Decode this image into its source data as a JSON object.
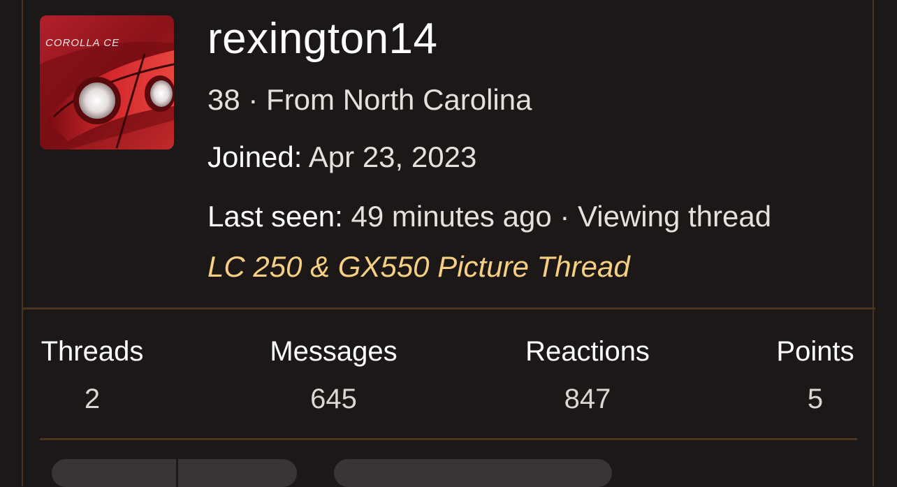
{
  "profile": {
    "username": "rexington14",
    "age_location": "38 · From North Carolina",
    "joined_label": "Joined:",
    "joined_value": "Apr 23, 2023",
    "last_seen_label": "Last seen:",
    "last_seen_value": "49 minutes ago · Viewing thread",
    "viewing_thread_title": "LC 250 & GX550 Picture Thread",
    "avatar_badge_text": "COROLLA CE",
    "avatar_icon": "car-taillight-photo"
  },
  "stats": [
    {
      "label": "Threads",
      "value": "2"
    },
    {
      "label": "Messages",
      "value": "645"
    },
    {
      "label": "Reactions",
      "value": "847"
    },
    {
      "label": "Points",
      "value": "5"
    }
  ],
  "colors": {
    "background": "#1c1818",
    "border": "#4a3620",
    "link": "#f7cf82",
    "text_primary": "#ffffff",
    "text_secondary": "#e6e1df"
  }
}
